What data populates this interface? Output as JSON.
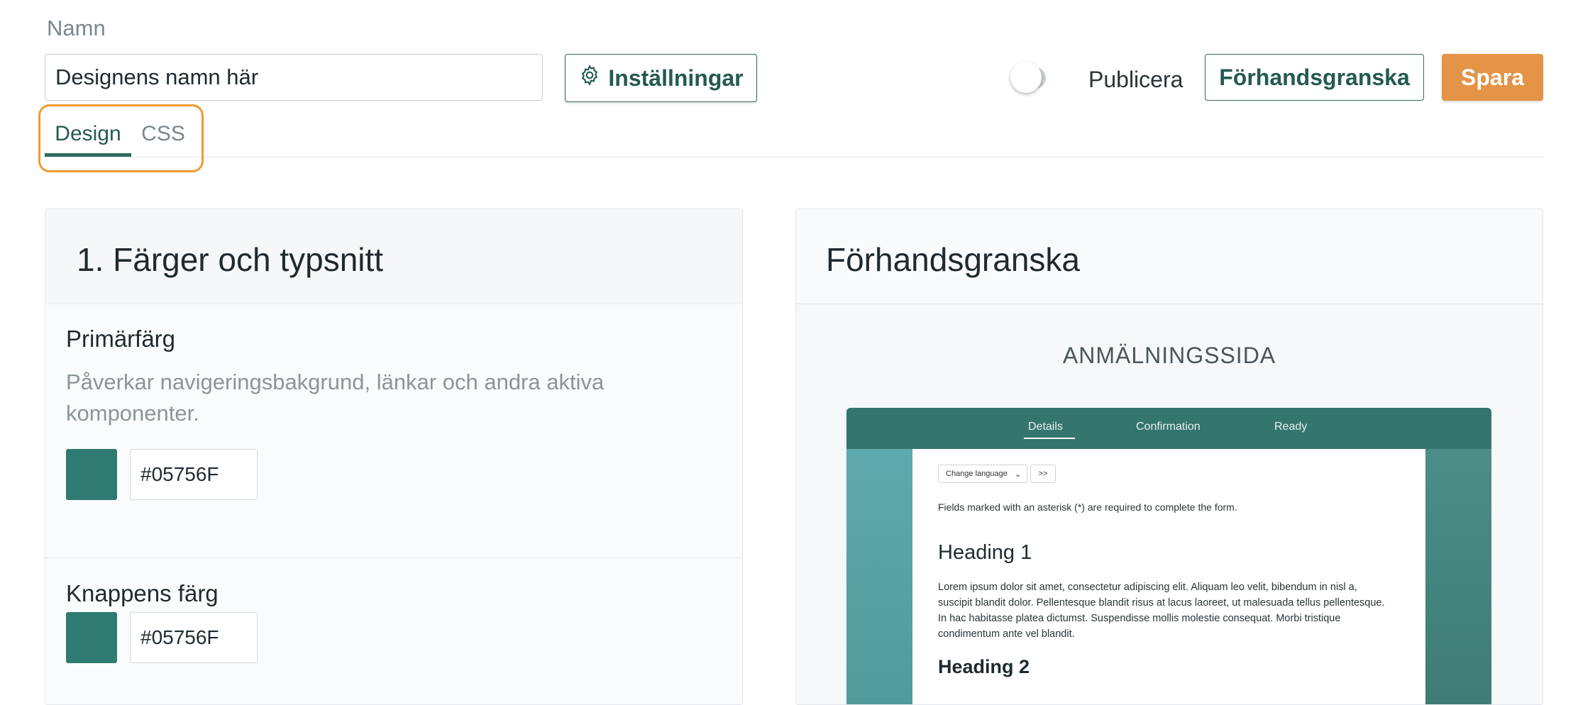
{
  "header": {
    "name_label": "Namn",
    "name_value": "Designens namn här",
    "settings_label": "Inställningar",
    "publish_label": "Publicera",
    "publish_on": false,
    "preview_label": "Förhandsgranska",
    "save_label": "Spara"
  },
  "tabs": [
    {
      "label": "Design",
      "active": true
    },
    {
      "label": "CSS",
      "active": false
    }
  ],
  "left_panel": {
    "title": "1. Färger och typsnitt",
    "sections": [
      {
        "title": "Primärfärg",
        "description": "Påverkar navigeringsbakgrund, länkar och andra aktiva komponenter.",
        "color": "#05756F",
        "swatch": "#2f7a71"
      },
      {
        "title": "Knappens färg",
        "color": "#05756F",
        "swatch": "#2f7a71"
      }
    ]
  },
  "right_panel": {
    "title": "Förhandsgranska",
    "page_label": "ANMÄLNINGSSIDA",
    "mock": {
      "nav": [
        "Details",
        "Confirmation",
        "Ready"
      ],
      "active_nav": "Details",
      "language_select": "Change language",
      "go_button": ">>",
      "required_note": "Fields marked with an asterisk (*) are required to complete the form.",
      "heading1": "Heading 1",
      "paragraph": "Lorem ipsum dolor sit amet, consectetur adipiscing elit. Aliquam leo velit, bibendum in nisl a, suscipit blandit dolor. Pellentesque blandit risus at lacus laoreet, ut malesuada tellus pellentesque. In hac habitasse platea dictumst. Suspendisse mollis molestie consequat. Morbi tristique condimentum ante vel blandit.",
      "heading2": "Heading 2"
    }
  },
  "colors": {
    "brand": "#2f6b60",
    "accent": "#e59346",
    "highlight": "#f09a32"
  },
  "icons": {
    "settings": "gear-icon"
  }
}
